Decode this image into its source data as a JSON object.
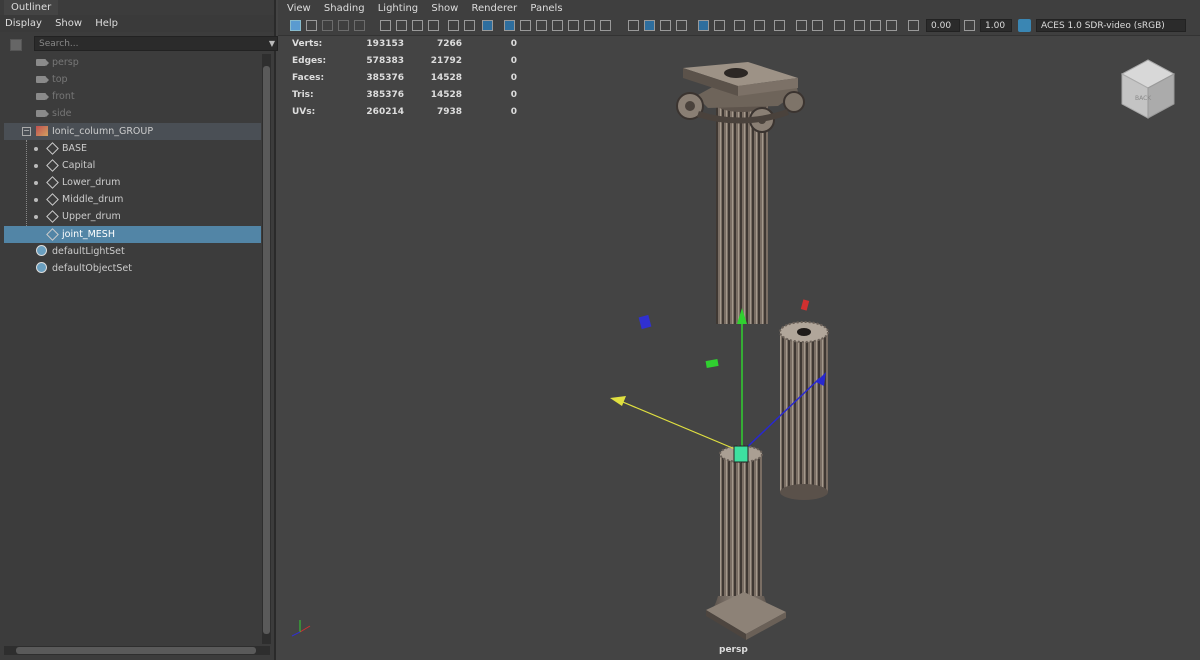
{
  "outliner": {
    "tab_title": "Outliner",
    "menu": [
      "Display",
      "Show",
      "Help"
    ],
    "search_placeholder": "Search...",
    "items": [
      {
        "label": "persp",
        "type": "camera",
        "dim": true
      },
      {
        "label": "top",
        "type": "camera",
        "dim": true
      },
      {
        "label": "front",
        "type": "camera",
        "dim": true
      },
      {
        "label": "side",
        "type": "camera",
        "dim": true
      },
      {
        "label": "Ionic_column_GROUP",
        "type": "group"
      },
      {
        "label": "BASE",
        "type": "mesh"
      },
      {
        "label": "Capital",
        "type": "mesh"
      },
      {
        "label": "Lower_drum",
        "type": "mesh"
      },
      {
        "label": "Middle_drum",
        "type": "mesh"
      },
      {
        "label": "Upper_drum",
        "type": "mesh"
      },
      {
        "label": "joint_MESH",
        "type": "mesh",
        "selected": true
      },
      {
        "label": "defaultLightSet",
        "type": "set"
      },
      {
        "label": "defaultObjectSet",
        "type": "set"
      }
    ]
  },
  "viewport": {
    "menu": [
      "View",
      "Shading",
      "Lighting",
      "Show",
      "Renderer",
      "Panels"
    ],
    "exposure": "0.00",
    "gamma": "1.00",
    "color_space": "ACES 1.0 SDR-video (sRGB)",
    "camera_label": "persp",
    "stats": [
      {
        "label": "Verts:",
        "v1": "193153",
        "v2": "7266",
        "v3": "0"
      },
      {
        "label": "Edges:",
        "v1": "578383",
        "v2": "21792",
        "v3": "0"
      },
      {
        "label": "Faces:",
        "v1": "385376",
        "v2": "14528",
        "v3": "0"
      },
      {
        "label": "Tris:",
        "v1": "385376",
        "v2": "14528",
        "v3": "0"
      },
      {
        "label": "UVs:",
        "v1": "260214",
        "v2": "7938",
        "v3": "0"
      }
    ],
    "viewcube_label": "BACK"
  },
  "colors": {
    "selection": "#5285a6",
    "viewport_bg": "#444444",
    "axis_x": "#d03030",
    "axis_y": "#30d030",
    "axis_z": "#3030d0"
  }
}
